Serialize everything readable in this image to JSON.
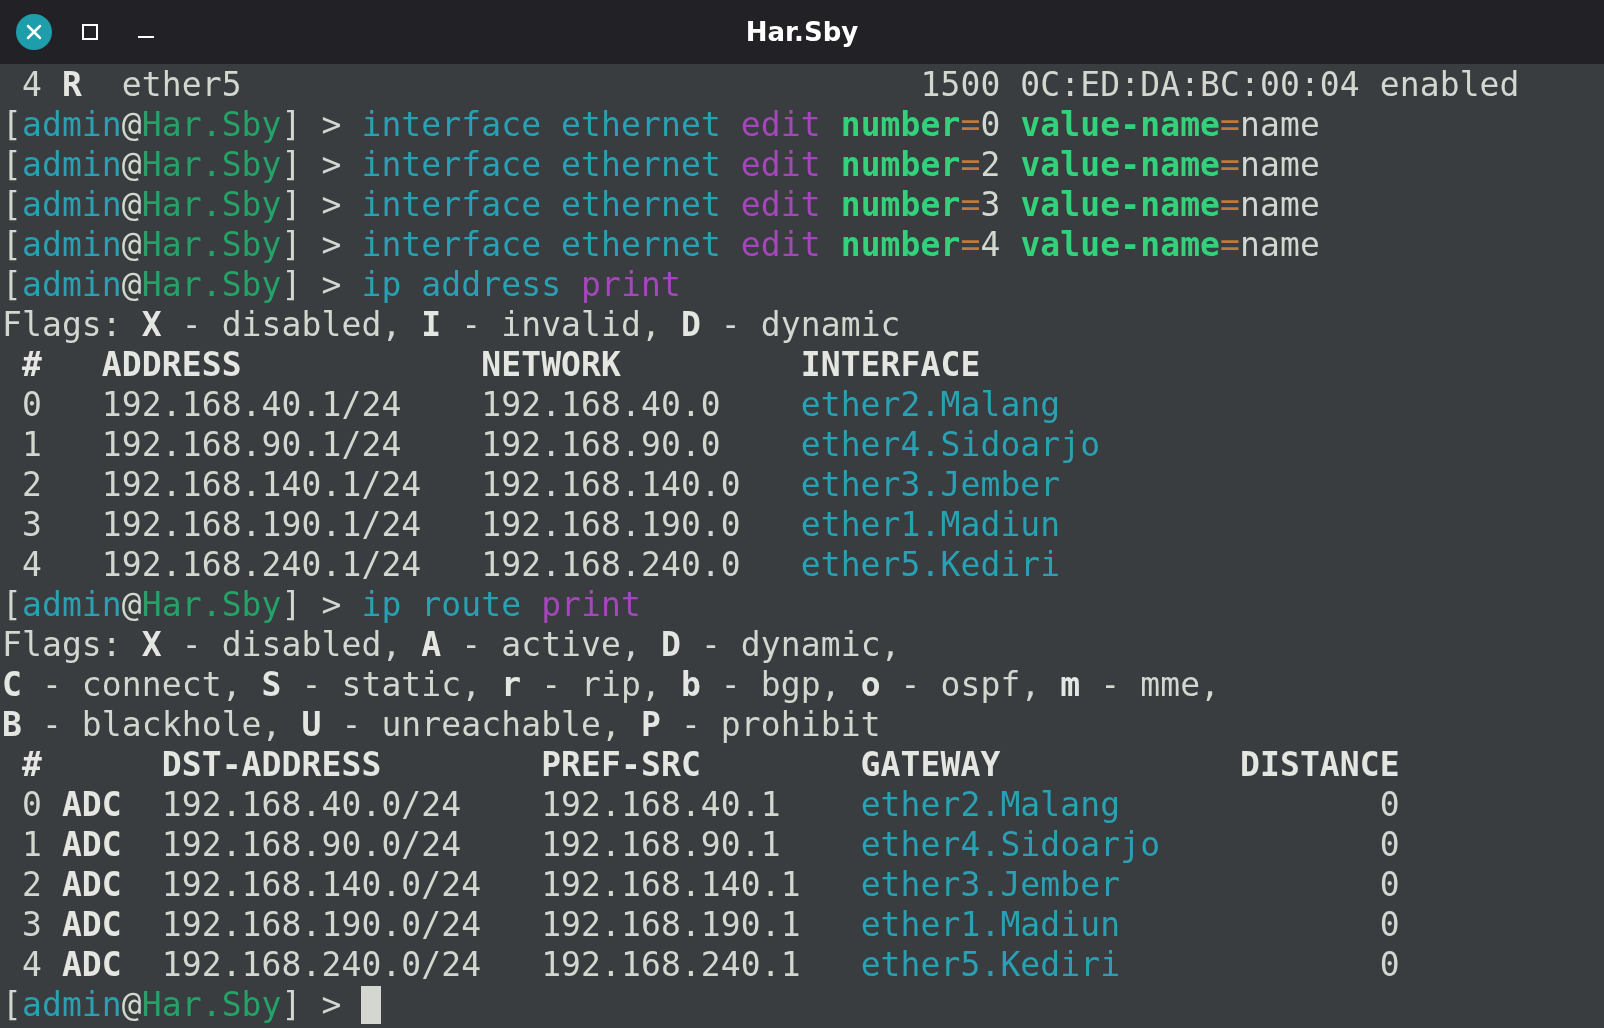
{
  "window": {
    "title": "Har.Sby"
  },
  "terminal": {
    "lines": [
      [
        {
          "text": " 4 ",
          "kind": "plain"
        },
        {
          "text": "R",
          "kind": "bold"
        },
        {
          "text": "  ether5                                  1500 0C:ED:DA:BC:00:04 enabled",
          "kind": "plain"
        }
      ],
      [
        {
          "text": "[",
          "kind": "plain"
        },
        {
          "text": "admin",
          "kind": "cmd"
        },
        {
          "text": "@",
          "kind": "plain"
        },
        {
          "text": "Har.Sby",
          "kind": "host"
        },
        {
          "text": "] > ",
          "kind": "plain"
        },
        {
          "text": "interface ethernet ",
          "kind": "cmd"
        },
        {
          "text": "edit ",
          "kind": "verb"
        },
        {
          "text": "number",
          "kind": "param"
        },
        {
          "text": "=",
          "kind": "eq"
        },
        {
          "text": "0 ",
          "kind": "plain"
        },
        {
          "text": "value-name",
          "kind": "param"
        },
        {
          "text": "=",
          "kind": "eq"
        },
        {
          "text": "name",
          "kind": "plain"
        }
      ],
      [
        {
          "text": "[",
          "kind": "plain"
        },
        {
          "text": "admin",
          "kind": "cmd"
        },
        {
          "text": "@",
          "kind": "plain"
        },
        {
          "text": "Har.Sby",
          "kind": "host"
        },
        {
          "text": "] > ",
          "kind": "plain"
        },
        {
          "text": "interface ethernet ",
          "kind": "cmd"
        },
        {
          "text": "edit ",
          "kind": "verb"
        },
        {
          "text": "number",
          "kind": "param"
        },
        {
          "text": "=",
          "kind": "eq"
        },
        {
          "text": "2 ",
          "kind": "plain"
        },
        {
          "text": "value-name",
          "kind": "param"
        },
        {
          "text": "=",
          "kind": "eq"
        },
        {
          "text": "name",
          "kind": "plain"
        }
      ],
      [
        {
          "text": "[",
          "kind": "plain"
        },
        {
          "text": "admin",
          "kind": "cmd"
        },
        {
          "text": "@",
          "kind": "plain"
        },
        {
          "text": "Har.Sby",
          "kind": "host"
        },
        {
          "text": "] > ",
          "kind": "plain"
        },
        {
          "text": "interface ethernet ",
          "kind": "cmd"
        },
        {
          "text": "edit ",
          "kind": "verb"
        },
        {
          "text": "number",
          "kind": "param"
        },
        {
          "text": "=",
          "kind": "eq"
        },
        {
          "text": "3 ",
          "kind": "plain"
        },
        {
          "text": "value-name",
          "kind": "param"
        },
        {
          "text": "=",
          "kind": "eq"
        },
        {
          "text": "name",
          "kind": "plain"
        }
      ],
      [
        {
          "text": "[",
          "kind": "plain"
        },
        {
          "text": "admin",
          "kind": "cmd"
        },
        {
          "text": "@",
          "kind": "plain"
        },
        {
          "text": "Har.Sby",
          "kind": "host"
        },
        {
          "text": "] > ",
          "kind": "plain"
        },
        {
          "text": "interface ethernet ",
          "kind": "cmd"
        },
        {
          "text": "edit ",
          "kind": "verb"
        },
        {
          "text": "number",
          "kind": "param"
        },
        {
          "text": "=",
          "kind": "eq"
        },
        {
          "text": "4 ",
          "kind": "plain"
        },
        {
          "text": "value-name",
          "kind": "param"
        },
        {
          "text": "=",
          "kind": "eq"
        },
        {
          "text": "name",
          "kind": "plain"
        }
      ],
      [
        {
          "text": "[",
          "kind": "plain"
        },
        {
          "text": "admin",
          "kind": "cmd"
        },
        {
          "text": "@",
          "kind": "plain"
        },
        {
          "text": "Har.Sby",
          "kind": "host"
        },
        {
          "text": "] > ",
          "kind": "plain"
        },
        {
          "text": "ip address ",
          "kind": "cmd"
        },
        {
          "text": "print",
          "kind": "verb"
        }
      ],
      [
        {
          "text": "Flags: ",
          "kind": "plain"
        },
        {
          "text": "X",
          "kind": "bold"
        },
        {
          "text": " - disabled, ",
          "kind": "plain"
        },
        {
          "text": "I",
          "kind": "bold"
        },
        {
          "text": " - invalid, ",
          "kind": "plain"
        },
        {
          "text": "D",
          "kind": "bold"
        },
        {
          "text": " - dynamic",
          "kind": "plain"
        }
      ],
      [
        {
          "text": " #   ADDRESS            NETWORK         INTERFACE",
          "kind": "bold"
        }
      ],
      [
        {
          "text": " 0   192.168.40.1/24    192.168.40.0    ",
          "kind": "plain"
        },
        {
          "text": "ether2.Malang",
          "kind": "cmd"
        }
      ],
      [
        {
          "text": " 1   192.168.90.1/24    192.168.90.0    ",
          "kind": "plain"
        },
        {
          "text": "ether4.Sidoarjo",
          "kind": "cmd"
        }
      ],
      [
        {
          "text": " 2   192.168.140.1/24   192.168.140.0   ",
          "kind": "plain"
        },
        {
          "text": "ether3.Jember",
          "kind": "cmd"
        }
      ],
      [
        {
          "text": " 3   192.168.190.1/24   192.168.190.0   ",
          "kind": "plain"
        },
        {
          "text": "ether1.Madiun",
          "kind": "cmd"
        }
      ],
      [
        {
          "text": " 4   192.168.240.1/24   192.168.240.0   ",
          "kind": "plain"
        },
        {
          "text": "ether5.Kediri",
          "kind": "cmd"
        }
      ],
      [
        {
          "text": "[",
          "kind": "plain"
        },
        {
          "text": "admin",
          "kind": "cmd"
        },
        {
          "text": "@",
          "kind": "plain"
        },
        {
          "text": "Har.Sby",
          "kind": "host"
        },
        {
          "text": "] > ",
          "kind": "plain"
        },
        {
          "text": "ip route ",
          "kind": "cmd"
        },
        {
          "text": "print",
          "kind": "verb"
        }
      ],
      [
        {
          "text": "Flags: ",
          "kind": "plain"
        },
        {
          "text": "X",
          "kind": "bold"
        },
        {
          "text": " - disabled, ",
          "kind": "plain"
        },
        {
          "text": "A",
          "kind": "bold"
        },
        {
          "text": " - active, ",
          "kind": "plain"
        },
        {
          "text": "D",
          "kind": "bold"
        },
        {
          "text": " - dynamic,",
          "kind": "plain"
        }
      ],
      [
        {
          "text": "C",
          "kind": "bold"
        },
        {
          "text": " - connect, ",
          "kind": "plain"
        },
        {
          "text": "S",
          "kind": "bold"
        },
        {
          "text": " - static, ",
          "kind": "plain"
        },
        {
          "text": "r",
          "kind": "bold"
        },
        {
          "text": " - rip, ",
          "kind": "plain"
        },
        {
          "text": "b",
          "kind": "bold"
        },
        {
          "text": " - bgp, ",
          "kind": "plain"
        },
        {
          "text": "o",
          "kind": "bold"
        },
        {
          "text": " - ospf, ",
          "kind": "plain"
        },
        {
          "text": "m",
          "kind": "bold"
        },
        {
          "text": " - mme,",
          "kind": "plain"
        }
      ],
      [
        {
          "text": "B",
          "kind": "bold"
        },
        {
          "text": " - blackhole, ",
          "kind": "plain"
        },
        {
          "text": "U",
          "kind": "bold"
        },
        {
          "text": " - unreachable, ",
          "kind": "plain"
        },
        {
          "text": "P",
          "kind": "bold"
        },
        {
          "text": " - prohibit",
          "kind": "plain"
        }
      ],
      [
        {
          "text": " #      DST-ADDRESS        PREF-SRC        GATEWAY            DISTANCE",
          "kind": "bold"
        }
      ],
      [
        {
          "text": " 0 ",
          "kind": "plain"
        },
        {
          "text": "ADC",
          "kind": "bold"
        },
        {
          "text": "  192.168.40.0/24    192.168.40.1    ",
          "kind": "plain"
        },
        {
          "text": "ether2.Malang",
          "kind": "cmd"
        },
        {
          "text": "             0",
          "kind": "plain"
        }
      ],
      [
        {
          "text": " 1 ",
          "kind": "plain"
        },
        {
          "text": "ADC",
          "kind": "bold"
        },
        {
          "text": "  192.168.90.0/24    192.168.90.1    ",
          "kind": "plain"
        },
        {
          "text": "ether4.Sidoarjo",
          "kind": "cmd"
        },
        {
          "text": "           0",
          "kind": "plain"
        }
      ],
      [
        {
          "text": " 2 ",
          "kind": "plain"
        },
        {
          "text": "ADC",
          "kind": "bold"
        },
        {
          "text": "  192.168.140.0/24   192.168.140.1   ",
          "kind": "plain"
        },
        {
          "text": "ether3.Jember",
          "kind": "cmd"
        },
        {
          "text": "             0",
          "kind": "plain"
        }
      ],
      [
        {
          "text": " 3 ",
          "kind": "plain"
        },
        {
          "text": "ADC",
          "kind": "bold"
        },
        {
          "text": "  192.168.190.0/24   192.168.190.1   ",
          "kind": "plain"
        },
        {
          "text": "ether1.Madiun",
          "kind": "cmd"
        },
        {
          "text": "             0",
          "kind": "plain"
        }
      ],
      [
        {
          "text": " 4 ",
          "kind": "plain"
        },
        {
          "text": "ADC",
          "kind": "bold"
        },
        {
          "text": "  192.168.240.0/24   192.168.240.1   ",
          "kind": "plain"
        },
        {
          "text": "ether5.Kediri",
          "kind": "cmd"
        },
        {
          "text": "             0",
          "kind": "plain"
        }
      ]
    ],
    "prompt": [
      {
        "text": "[",
        "kind": "plain"
      },
      {
        "text": "admin",
        "kind": "cmd"
      },
      {
        "text": "@",
        "kind": "plain"
      },
      {
        "text": "Har.Sby",
        "kind": "host"
      },
      {
        "text": "] > ",
        "kind": "plain"
      }
    ]
  }
}
